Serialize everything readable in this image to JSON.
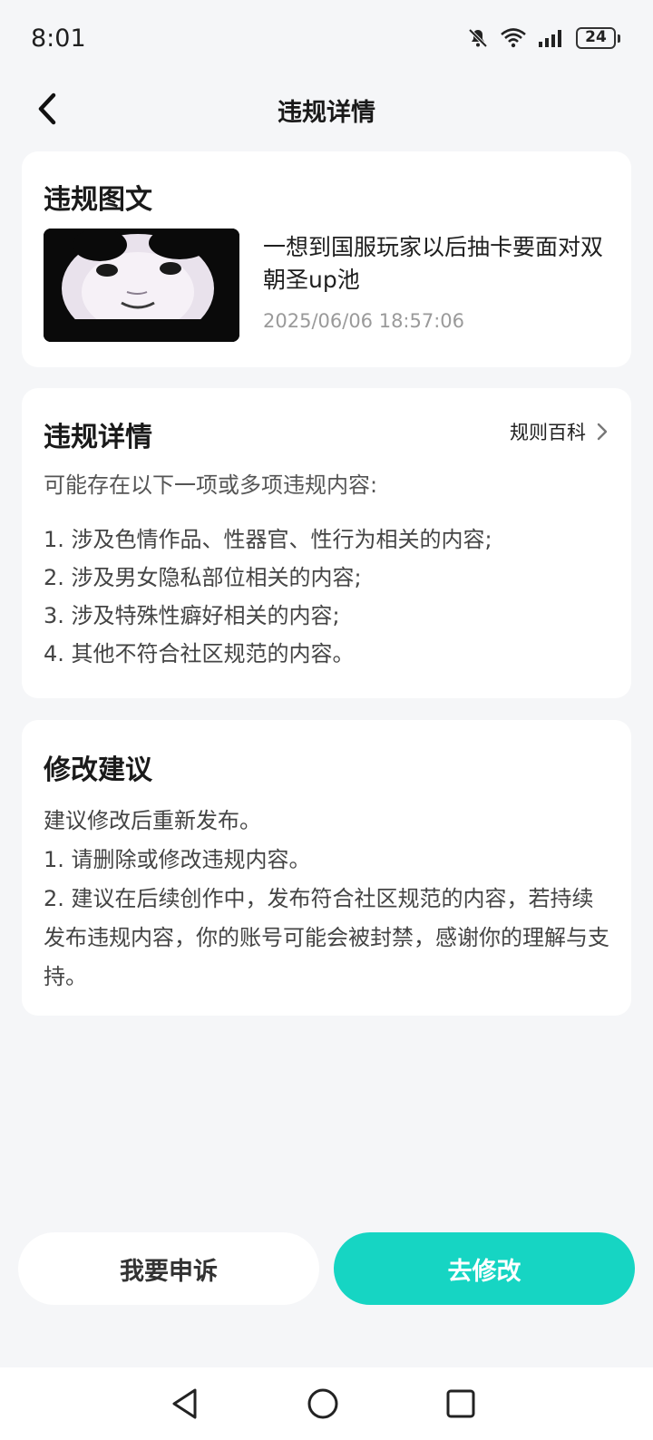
{
  "status_bar": {
    "time": "8:01",
    "battery": "24",
    "icons": [
      "bell-muted-icon",
      "wifi-icon",
      "signal-icon",
      "battery-icon"
    ]
  },
  "nav": {
    "title": "违规详情",
    "back_icon": "chevron-left-icon"
  },
  "post_card": {
    "title": "违规图文",
    "text": "一想到国服玩家以后抽卡要面对双朝圣up池",
    "time": "2025/06/06 18:57:06"
  },
  "detail_card": {
    "title": "违规详情",
    "rules_link": "规则百科",
    "intro": "可能存在以下一项或多项违规内容:",
    "items": [
      "1. 涉及色情作品、性器官、性行为相关的内容;",
      "2. 涉及男女隐私部位相关的内容;",
      "3. 涉及特殊性癖好相关的内容;",
      "4. 其他不符合社区规范的内容。"
    ]
  },
  "suggest_card": {
    "title": "修改建议",
    "lines": [
      "建议修改后重新发布。",
      "1. 请删除或修改违规内容。",
      "2. 建议在后续创作中，发布符合社区规范的内容，若持续发布违规内容，你的账号可能会被封禁，感谢你的理解与支持。"
    ]
  },
  "actions": {
    "appeal": "我要申诉",
    "edit": "去修改"
  },
  "colors": {
    "accent": "#16d5c3",
    "background": "#f5f6f8",
    "card": "#ffffff",
    "muted_text": "#9a9a9a"
  }
}
